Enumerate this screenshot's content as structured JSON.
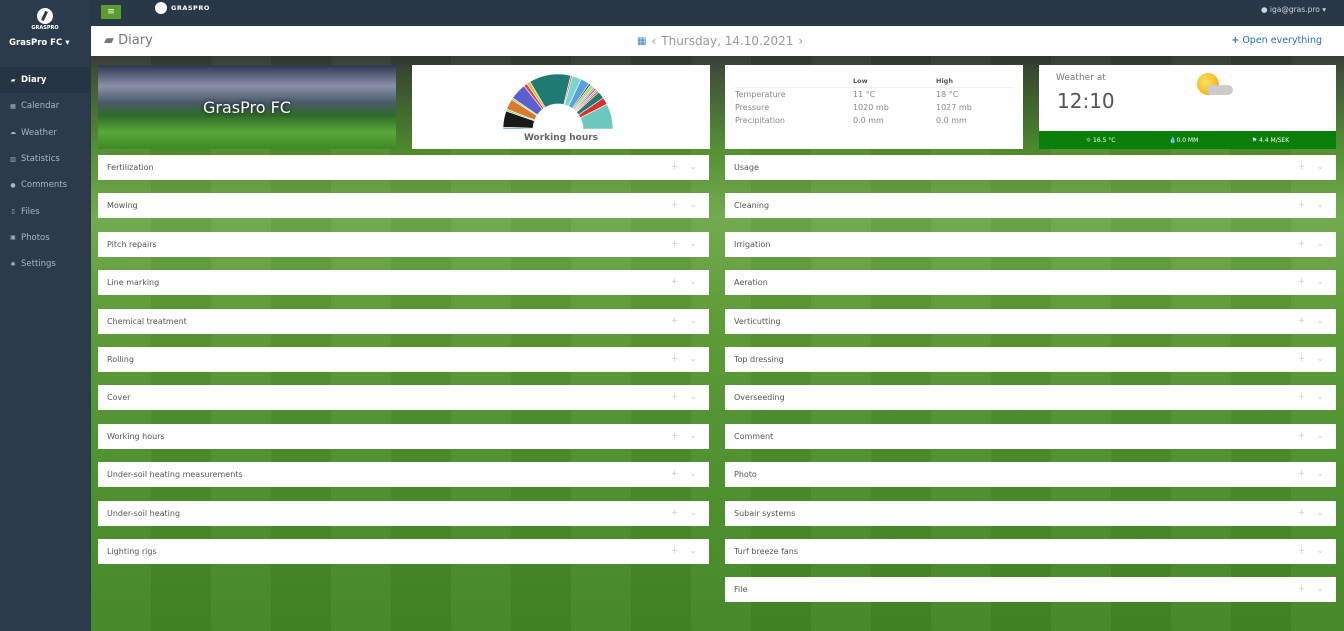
{
  "app": {
    "brand": "GRASPRO",
    "club": "GrasPro FC",
    "user": "iga@gras.pro"
  },
  "sidebar": {
    "items": [
      {
        "label": "Diary",
        "icon": "book-icon"
      },
      {
        "label": "Calendar",
        "icon": "calendar-icon"
      },
      {
        "label": "Weather",
        "icon": "cloud-icon"
      },
      {
        "label": "Statistics",
        "icon": "bar-chart-icon"
      },
      {
        "label": "Comments",
        "icon": "comment-icon"
      },
      {
        "label": "Files",
        "icon": "file-icon"
      },
      {
        "label": "Photos",
        "icon": "image-icon"
      },
      {
        "label": "Settings",
        "icon": "gear-icon"
      }
    ]
  },
  "header": {
    "title": "Diary",
    "date": "Thursday, 14.10.2021",
    "prev": "‹",
    "next": "›",
    "open_all": "Open everything"
  },
  "banner": {
    "title": "GrasPro FC"
  },
  "working_hours": {
    "title": "Working hours",
    "slices": [
      {
        "v": 1,
        "c": "#5b9bd5"
      },
      {
        "v": 9,
        "c": "#1a1a1a"
      },
      {
        "v": 1,
        "c": "#6bd36b"
      },
      {
        "v": 6,
        "c": "#d97a2a"
      },
      {
        "v": 1,
        "c": "#7bd37b"
      },
      {
        "v": 9,
        "c": "#5c5fd0"
      },
      {
        "v": 2,
        "c": "#e0405a"
      },
      {
        "v": 2,
        "c": "#d6c43a"
      },
      {
        "v": 23,
        "c": "#1e7a72"
      },
      {
        "v": 1,
        "c": "#e06060"
      },
      {
        "v": 5,
        "c": "#76d6d0"
      },
      {
        "v": 5,
        "c": "#5aa0dc"
      },
      {
        "v": 1,
        "c": "#333"
      },
      {
        "v": 2,
        "c": "#a0e070"
      },
      {
        "v": 1,
        "c": "#e07ab0"
      },
      {
        "v": 1,
        "c": "#5a60d0"
      },
      {
        "v": 1,
        "c": "#e0a040"
      },
      {
        "v": 1,
        "c": "#d04040"
      },
      {
        "v": 4,
        "c": "#1e7a72"
      },
      {
        "v": 4,
        "c": "#d93030"
      },
      {
        "v": 14,
        "c": "#6cc8be"
      }
    ]
  },
  "temperature": {
    "headers": [
      "",
      "Low",
      "High"
    ],
    "rows": [
      [
        "Temperature",
        "11 °C",
        "18 °C"
      ],
      [
        "Pressure",
        "1020 mb",
        "1027 mb"
      ],
      [
        "Precipitation",
        "0.0 mm",
        "0.0 mm"
      ]
    ]
  },
  "weather": {
    "label": "Weather at",
    "time": "12:10",
    "temp": "16.5 °C",
    "rain": "0.0 MM",
    "wind": "4.4 M/SEK",
    "bar_color": "#0a7f0a"
  },
  "panels_left": [
    "Fertilization",
    "Mowing",
    "Pitch repairs",
    "Line marking",
    "Chemical treatment",
    "Rolling",
    "Cover",
    "Working hours",
    "Under-soil heating measurements",
    "Under-soil heating",
    "Lighting rigs"
  ],
  "panels_right": [
    "Usage",
    "Cleaning",
    "Irrigation",
    "Aeration",
    "Verticutting",
    "Top dressing",
    "Overseeding",
    "Comment",
    "Photo",
    "Subair systems",
    "Turf breeze fans",
    "File"
  ],
  "panel_actions": {
    "add": "+",
    "expand": "⌄"
  }
}
